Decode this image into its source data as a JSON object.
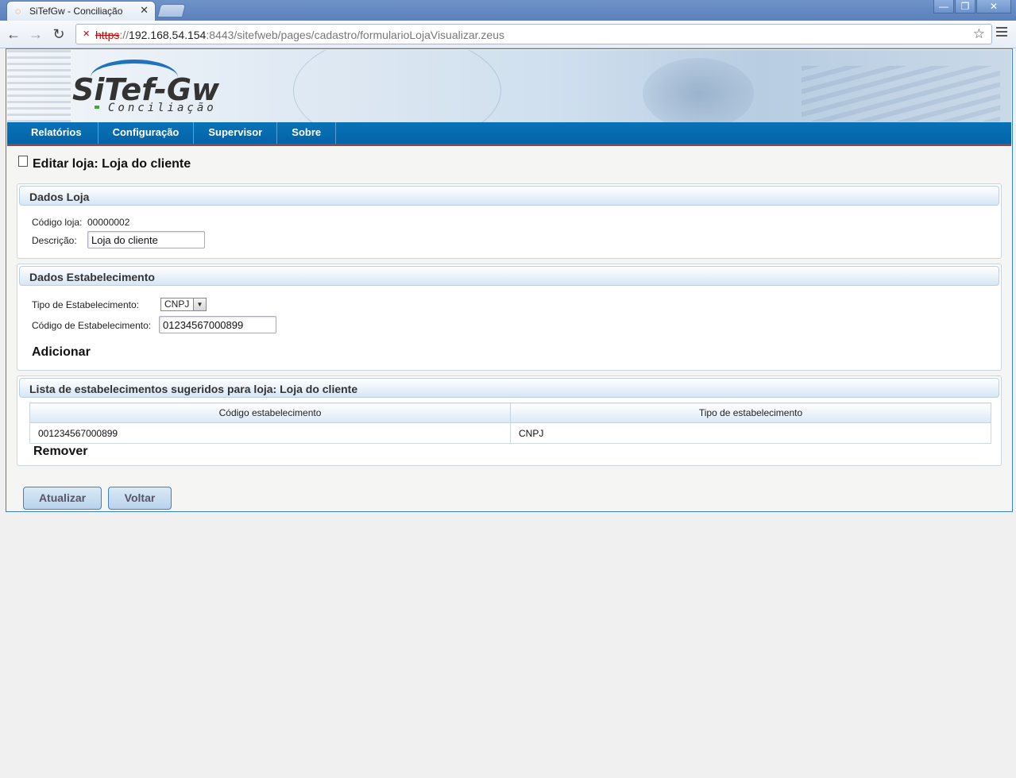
{
  "browser": {
    "tab_title": "SiTefGw - Conciliação",
    "tab_close": "✕",
    "url_protocol": "https",
    "url_separator": "://",
    "url_host": "192.168.54.154",
    "url_rest": ":8443/sitefweb/pages/cadastro/formularioLojaVisualizar.zeus",
    "window_buttons": [
      "—",
      "❐",
      "✕"
    ],
    "icons": [
      "back-icon",
      "forward-icon",
      "reload-icon",
      "insecure-lock-icon",
      "star-icon",
      "menu-icon"
    ]
  },
  "header": {
    "logo_text": "SiTef-Gw",
    "logo_subtitle": "Conciliação",
    "menu": [
      "Relatórios",
      "Configuração",
      "Supervisor",
      "Sobre"
    ]
  },
  "page": {
    "title": "Editar loja: Loja do cliente"
  },
  "dados_loja": {
    "header": "Dados Loja",
    "codigo_label": "Código loja:",
    "codigo_value": "00000002",
    "descricao_label": "Descrição:",
    "descricao_value": "Loja do cliente"
  },
  "dados_estabelecimento": {
    "header": "Dados Estabelecimento",
    "tipo_label": "Tipo de Estabelecimento:",
    "tipo_selected": "CNPJ",
    "codigo_label": "Código de Estabelecimento:",
    "codigo_value": "01234567000899",
    "add_link": "Adicionar"
  },
  "lista": {
    "header": "Lista de estabelecimentos sugeridos para loja: Loja do cliente",
    "columns": [
      "Código estabelecimento",
      "Tipo de estabelecimento"
    ],
    "rows": [
      [
        "001234567000899",
        "CNPJ"
      ]
    ],
    "remove_link": "Remover"
  },
  "actions": {
    "update": "Atualizar",
    "back": "Voltar"
  },
  "colors": {
    "menu_bar": "#0a72b8",
    "panel_header": "#d6e6f5",
    "button": "#b9d3ec"
  }
}
